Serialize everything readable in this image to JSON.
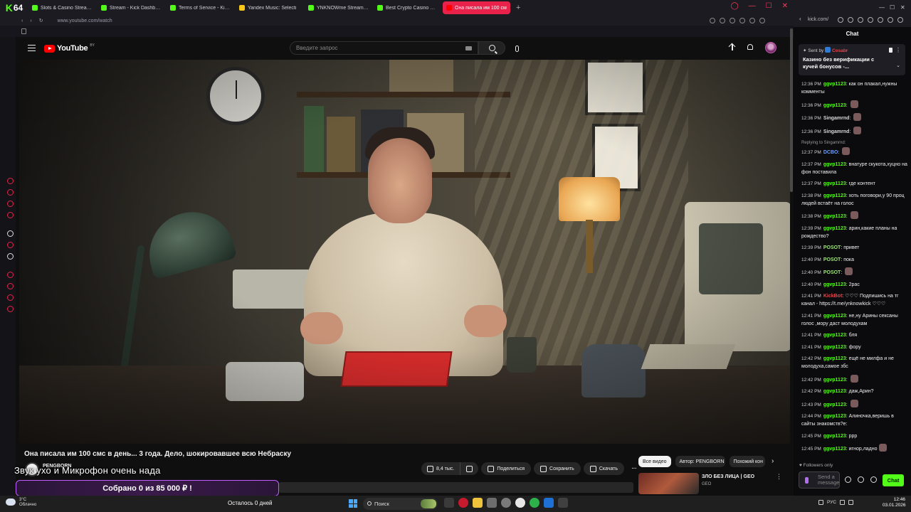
{
  "browser": {
    "logo_text": "64",
    "tabs": [
      {
        "title": "Slots & Casino Streaming",
        "color": "#53fc18"
      },
      {
        "title": "Stream - Kick Dashboard",
        "color": "#53fc18"
      },
      {
        "title": "Terms of Service - Kick St",
        "color": "#53fc18"
      },
      {
        "title": "Yandex Music: Selecti",
        "color": "#f5c518"
      },
      {
        "title": "YNKNOWme Stream - Wa",
        "color": "#53fc18"
      },
      {
        "title": "Best Crypto Casino & Bitc",
        "color": "#53fc18"
      },
      {
        "title": "Она писала им 100 см",
        "color": "#ff0000"
      }
    ],
    "new_tab": "+",
    "url": "www.youtube.com/watch"
  },
  "youtube": {
    "logo": "YouTube",
    "region": "BY",
    "search_placeholder": "Введите запрос",
    "video_title": "Она писала им 100 смс в день... 3 года. Дело, шокировавшее всю Небраску",
    "channel": "PENGBORN",
    "actions": {
      "likes": "8,4 тыс.",
      "share": "Поделиться",
      "save": "Сохранить",
      "download": "Скачать",
      "more": "···"
    },
    "chips": [
      "Все видео",
      "Автор: PENGBORN",
      "Похожий кон"
    ],
    "chips_next": "›",
    "recommendation": {
      "title": "ЗЛО БЕЗ ЛИЦА | GEO",
      "channel": "GEO"
    }
  },
  "overlay": {
    "banner": "Звук ухо и Микрофон очень нада",
    "donation": "Собрано 0  из 85 000 ₽ !"
  },
  "chat": {
    "url": "kick.com/",
    "title": "Chat",
    "pinned": {
      "sent_by_label": "Sent by",
      "sender": "Cosabr",
      "message": "Казино без верификации с кучей бонусов -..."
    },
    "messages": [
      {
        "time": "12:36 PM",
        "user": "ggvp1123",
        "color": "#53fc18",
        "text": "как он плакал,нужны комменты",
        "emote": false
      },
      {
        "time": "12:36 PM",
        "user": "ggvp1123",
        "color": "#53fc18",
        "text": "",
        "emote": true
      },
      {
        "time": "12:36 PM",
        "user": "Singamrnd",
        "color": "#d8d8d8",
        "text": "",
        "emote": true
      },
      {
        "time": "12:36 PM",
        "user": "Singamrnd",
        "color": "#d8d8d8",
        "text": "",
        "emote": true
      },
      {
        "time": "12:37 PM",
        "user": "DCBO",
        "color": "#6ca0ff",
        "text": "",
        "emote": true,
        "reply": "Replying to Singamrnd:"
      },
      {
        "time": "12:37 PM",
        "user": "ggvp1123",
        "color": "#53fc18",
        "text": "внатуре скукота,хуцно на фон поставила",
        "emote": false
      },
      {
        "time": "12:37 PM",
        "user": "ggvp1123",
        "color": "#53fc18",
        "text": "где контент",
        "emote": false
      },
      {
        "time": "12:38 PM",
        "user": "ggvp1123",
        "color": "#53fc18",
        "text": "хоть поговори,у 90 проц людей встаёт на голос",
        "emote": false
      },
      {
        "time": "12:38 PM",
        "user": "ggvp1123",
        "color": "#53fc18",
        "text": "",
        "emote": true
      },
      {
        "time": "12:39 PM",
        "user": "ggvp1123",
        "color": "#53fc18",
        "text": "арин,какие планы на рождество?",
        "emote": false
      },
      {
        "time": "12:39 PM",
        "user": "POSOT",
        "color": "#9ee07a",
        "text": "привет",
        "emote": false
      },
      {
        "time": "12:40 PM",
        "user": "POSOT",
        "color": "#9ee07a",
        "text": "пока",
        "emote": false
      },
      {
        "time": "12:40 PM",
        "user": "POSOT",
        "color": "#9ee07a",
        "text": "",
        "emote": true
      },
      {
        "time": "12:40 PM",
        "user": "ggvp1123",
        "color": "#53fc18",
        "text": "2рас",
        "emote": false
      },
      {
        "time": "12:41 PM",
        "user": "KickBot",
        "color": "#e5484d",
        "text": "♡♡♡ Подпишись на тг канал - https://t.me/ynknowkick ♡♡♡",
        "emote": false
      },
      {
        "time": "12:41 PM",
        "user": "ggvp1123",
        "color": "#53fc18",
        "text": "не,ну Арины сексаны голос ,мору даст молодухам",
        "emote": false
      },
      {
        "time": "12:41 PM",
        "user": "ggvp1123",
        "color": "#53fc18",
        "text": "бля",
        "emote": false
      },
      {
        "time": "12:41 PM",
        "user": "ggvp1123",
        "color": "#53fc18",
        "text": "фору",
        "emote": false
      },
      {
        "time": "12:42 PM",
        "user": "ggvp1123",
        "color": "#53fc18",
        "text": "ещё не милфа и не молодуха,самое збс",
        "emote": false
      },
      {
        "time": "12:42 PM",
        "user": "ggvp1123",
        "color": "#53fc18",
        "text": "",
        "emote": true
      },
      {
        "time": "12:42 PM",
        "user": "ggvp1123",
        "color": "#53fc18",
        "text": "даж,Арин?",
        "emote": false
      },
      {
        "time": "12:43 PM",
        "user": "ggvp1123",
        "color": "#53fc18",
        "text": "",
        "emote": true
      },
      {
        "time": "12:44 PM",
        "user": "ggvp1123",
        "color": "#53fc18",
        "text": "Алиночка,веришь в сайты знакомств?е:",
        "emote": false
      },
      {
        "time": "12:45 PM",
        "user": "ggvp1123",
        "color": "#53fc18",
        "text": "ррр",
        "emote": false
      },
      {
        "time": "12:45 PM",
        "user": "ggvp1123",
        "color": "#53fc18",
        "text": "игнор,ладно",
        "emote": true
      }
    ],
    "followers_only": "Followers only",
    "input_placeholder": "Send a message",
    "send_label": "Chat"
  },
  "taskbar": {
    "temperature": "3°C",
    "weather": "Облачно",
    "center_text": "Осталось 0 дней",
    "search_label": "Поиск",
    "language": "РУС",
    "time": "12:46",
    "date": "03.01.2026"
  }
}
